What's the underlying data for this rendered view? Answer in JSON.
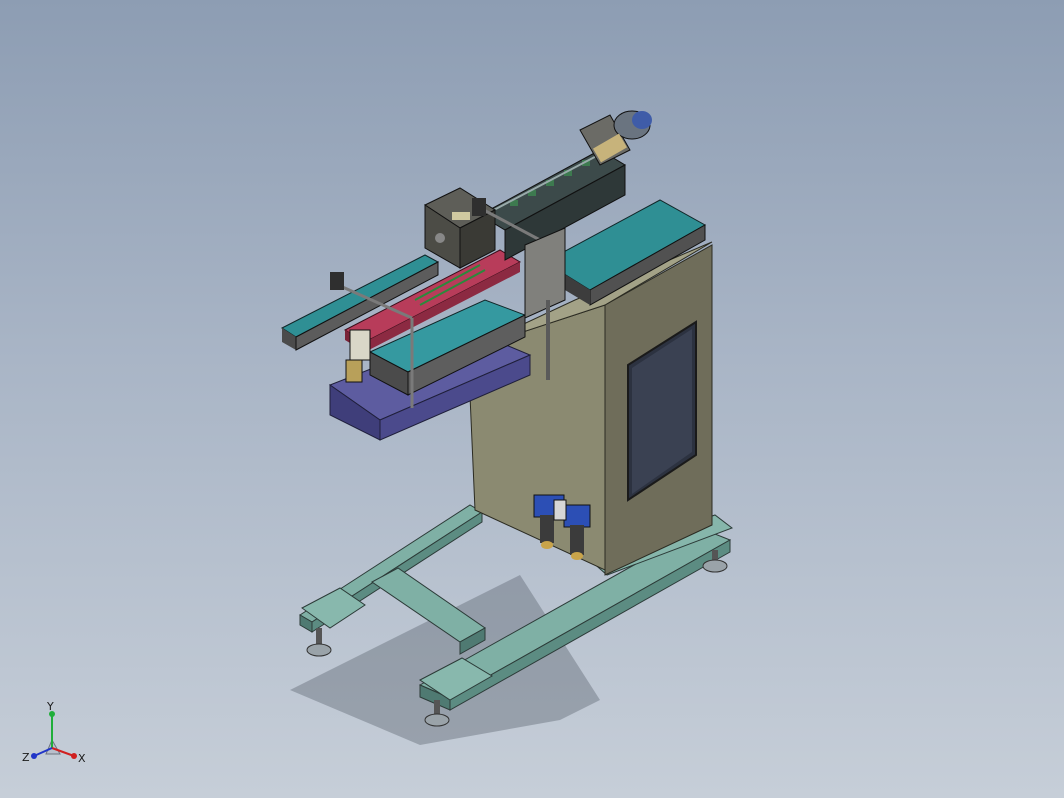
{
  "viewport": {
    "background_top": "#8d9db3",
    "background_bottom": "#c6ced8"
  },
  "model": {
    "frame_color": "#6f9e94",
    "cabinet_color": "#8c8a72",
    "conveyor_belt_color": "#2f8f94",
    "carriage_color": "#b83c5a",
    "base_block_color": "#5a5a9a",
    "regulator_color": "#2c4fb5"
  },
  "triad": {
    "y_label": "Y",
    "x_label": "X",
    "z_label": "Z",
    "y_color": "#1fae3a",
    "x_color": "#d02020",
    "z_color": "#2035c8"
  }
}
